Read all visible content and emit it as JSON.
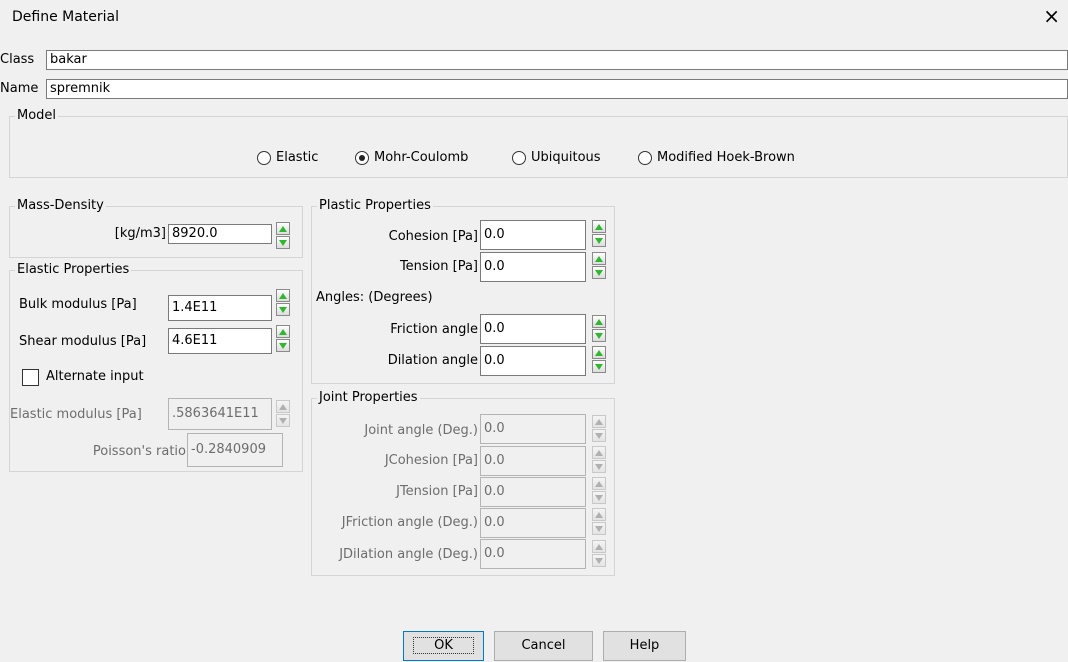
{
  "window": {
    "title": "Define Material",
    "close_symbol": "×"
  },
  "class": {
    "label": "Class",
    "value": "bakar"
  },
  "name": {
    "label": "Name",
    "value": "spremnik"
  },
  "model": {
    "legend": "Model",
    "options": [
      {
        "label": "Elastic",
        "selected": false
      },
      {
        "label": "Mohr-Coulomb",
        "selected": true
      },
      {
        "label": "Ubiquitous",
        "selected": false
      },
      {
        "label": "Modified Hoek-Brown",
        "selected": false
      }
    ]
  },
  "mass_density": {
    "legend": "Mass-Density",
    "unit_label": "[kg/m3]",
    "value": "8920.0"
  },
  "elastic": {
    "legend": "Elastic Properties",
    "bulk_label": "Bulk modulus   [Pa]",
    "bulk_value": "1.4E11",
    "shear_label": "Shear modulus [Pa]",
    "shear_value": "4.6E11",
    "alternate_label": "Alternate input",
    "alternate_checked": false,
    "elastic_mod_label": "Elastic modulus [Pa]",
    "elastic_mod_value": ".5863641E11",
    "poisson_label": "Poisson's ratio",
    "poisson_value": "-0.2840909"
  },
  "plastic": {
    "legend": "Plastic Properties",
    "cohesion_label": "Cohesion [Pa]",
    "cohesion_value": "0.0",
    "tension_label": "Tension   [Pa]",
    "tension_value": "0.0",
    "angles_label": "Angles: (Degrees)",
    "friction_label": "Friction angle",
    "friction_value": "0.0",
    "dilation_label": "Dilation angle",
    "dilation_value": "0.0"
  },
  "joint": {
    "legend": "Joint Properties",
    "angle_label": "Joint angle (Deg.)",
    "angle_value": "0.0",
    "jcohesion_label": "JCohesion [Pa]",
    "jcohesion_value": "0.0",
    "jtension_label": "JTension   [Pa]",
    "jtension_value": "0.0",
    "jfriction_label": "JFriction angle (Deg.)",
    "jfriction_value": "0.0",
    "jdilation_label": "JDilation angle (Deg.)",
    "jdilation_value": "0.0"
  },
  "buttons": {
    "ok": "OK",
    "cancel": "Cancel",
    "help": "Help"
  },
  "colors": {
    "spinner_arrow": "#2eb82e",
    "default_button_border": "#0078d7"
  }
}
